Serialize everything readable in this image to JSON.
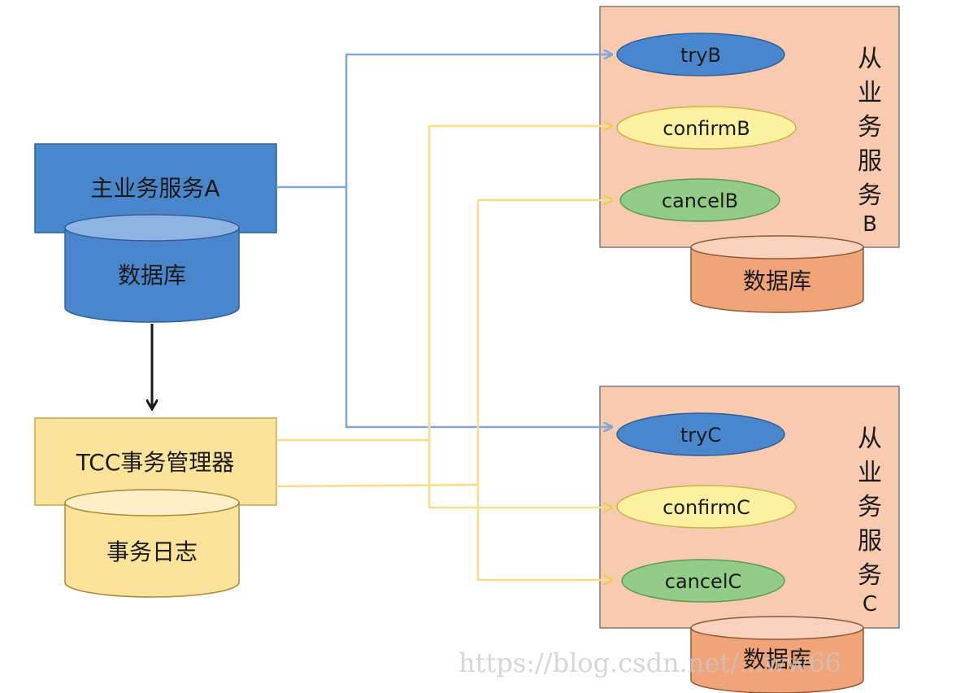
{
  "colors": {
    "main_box": "#4a86cc",
    "main_box_border": "#3a6aa8",
    "main_db": "#4a86cc",
    "main_db_top": "#8fb3e3",
    "tcc_box": "#fbe39a",
    "tcc_box_border": "#d4b85a",
    "tcc_db": "#fbe39a",
    "tcc_db_top": "#fdf0c6",
    "service_panel": "#f8cbb0",
    "service_panel_border": "#7a7a7a",
    "service_db": "#f0a477",
    "service_db_top": "#f8d2bb",
    "try_ellipse": "#4a86cc",
    "confirm_ellipse": "#fdf0a0",
    "cancel_ellipse": "#93cc86",
    "blue_connector": "#7fa8d8",
    "yellow_connector": "#f7dd8a",
    "black_arrow": "#1a1a1a"
  },
  "main_service": {
    "label": "主业务服务A",
    "db_label": "数据库"
  },
  "tcc_manager": {
    "label": "TCC事务管理器",
    "db_label": "事务日志"
  },
  "service_b": {
    "title_chars": [
      "从",
      "业",
      "务",
      "服",
      "务",
      "B"
    ],
    "try_label": "tryB",
    "confirm_label": "confirmB",
    "cancel_label": "cancelB",
    "db_label": "数据库"
  },
  "service_c": {
    "title_chars": [
      "从",
      "业",
      "务",
      "服",
      "务",
      "C"
    ],
    "try_label": "tryC",
    "confirm_label": "confirmC",
    "cancel_label": "cancelC",
    "db_label": "数据库"
  },
  "watermark": "https://blog.csdn.net/...ww66"
}
